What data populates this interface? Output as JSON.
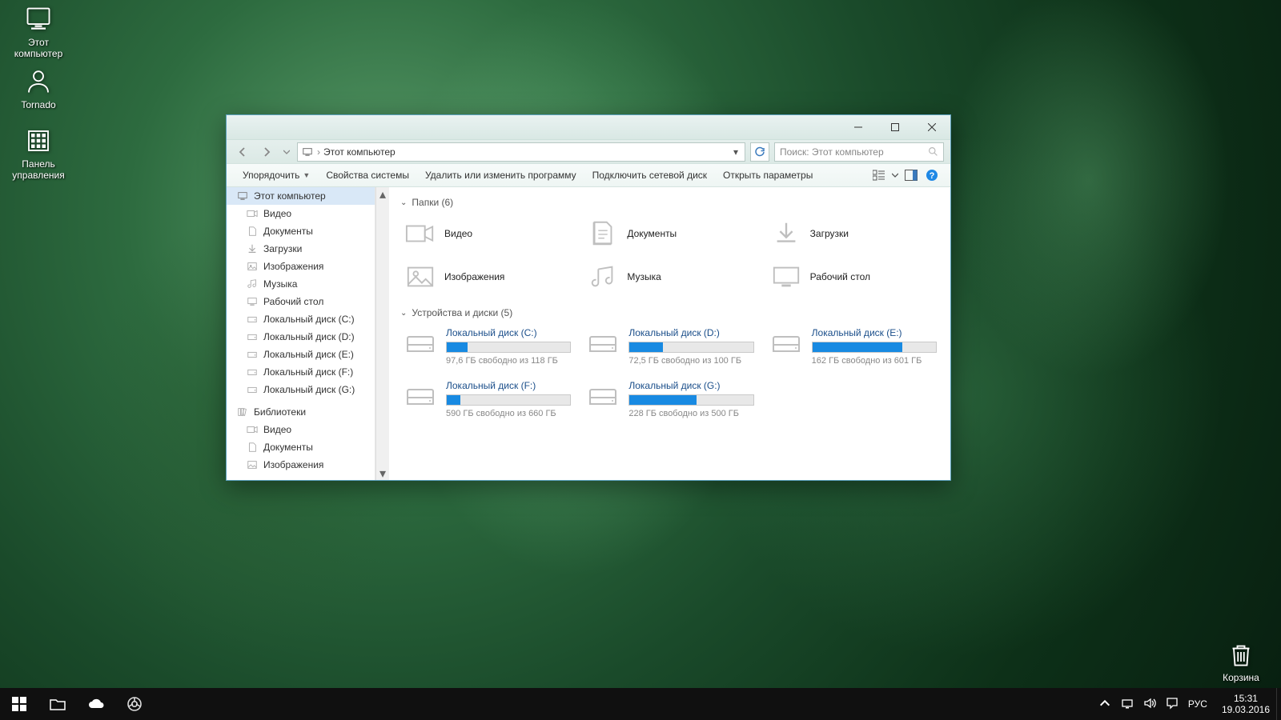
{
  "desktop": {
    "computer": "Этот компьютер",
    "tornado": "Tornado",
    "panel": "Панель управления",
    "trash": "Корзина"
  },
  "taskbar": {
    "lang": "РУС",
    "time": "15:31",
    "date": "19.03.2016"
  },
  "window": {
    "address": "Этот компьютер",
    "search_placeholder": "Поиск: Этот компьютер",
    "cmd": {
      "organize": "Упорядочить",
      "props": "Свойства системы",
      "uninstall": "Удалить или изменить программу",
      "mapdrive": "Подключить сетевой диск",
      "settings": "Открыть параметры"
    },
    "nav": {
      "this_pc": "Этот компьютер",
      "video": "Видео",
      "documents": "Документы",
      "downloads": "Загрузки",
      "pictures": "Изображения",
      "music": "Музыка",
      "desktop": "Рабочий стол",
      "c": "Локальный диск (C:)",
      "d": "Локальный диск (D:)",
      "e": "Локальный диск (E:)",
      "f": "Локальный диск (F:)",
      "g": "Локальный диск (G:)",
      "libraries": "Библиотеки",
      "lib_video": "Видео",
      "lib_docs": "Документы",
      "lib_pics": "Изображения"
    },
    "groups": {
      "folders": "Папки (6)",
      "drives": "Устройства и диски (5)"
    },
    "folders": {
      "video": "Видео",
      "documents": "Документы",
      "downloads": "Загрузки",
      "pictures": "Изображения",
      "music": "Музыка",
      "desktop": "Рабочий стол"
    },
    "drives": {
      "c": {
        "name": "Локальный диск (C:)",
        "free": "97,6 ГБ свободно из 118 ГБ",
        "pct": 17
      },
      "d": {
        "name": "Локальный диск (D:)",
        "free": "72,5 ГБ свободно из 100 ГБ",
        "pct": 27
      },
      "e": {
        "name": "Локальный диск (E:)",
        "free": "162 ГБ свободно из 601 ГБ",
        "pct": 73
      },
      "f": {
        "name": "Локальный диск (F:)",
        "free": "590 ГБ свободно из 660 ГБ",
        "pct": 11
      },
      "g": {
        "name": "Локальный диск (G:)",
        "free": "228 ГБ свободно из 500 ГБ",
        "pct": 54
      }
    }
  }
}
